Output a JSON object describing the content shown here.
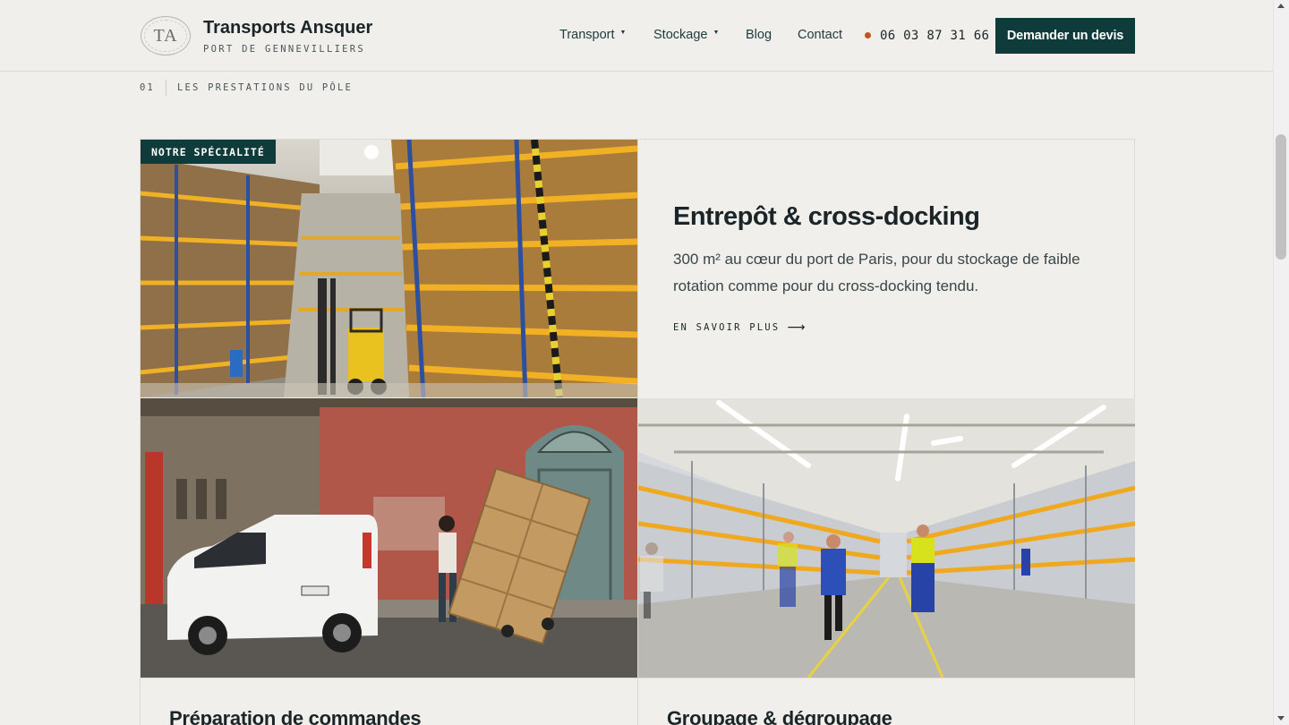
{
  "header": {
    "logo_text": "TA",
    "brand_title": "Transports Ansquer",
    "brand_subtitle": "PORT DE GENNEVILLIERS",
    "nav": [
      {
        "label": "Transport",
        "has_dropdown": true
      },
      {
        "label": "Stockage",
        "has_dropdown": true
      },
      {
        "label": "Blog",
        "has_dropdown": false
      },
      {
        "label": "Contact",
        "has_dropdown": false
      }
    ],
    "phone": "06 03 87 31 66",
    "cta_label": "Demander un devis"
  },
  "section": {
    "number": "01",
    "label": "LES PRESTATIONS DU PÔLE"
  },
  "featured": {
    "badge": "NOTRE SPÉCIALITÉ",
    "title": "Entrepôt & cross-docking",
    "description": "300 m² au cœur du port de Paris, pour du stockage de faible rotation comme pour du cross-docking tendu.",
    "link_label": "EN SAVOIR PLUS",
    "link_icon": "arrow-right-icon"
  },
  "cards": [
    {
      "title": "Préparation de commandes",
      "image": "delivery-van-boxes-photo"
    },
    {
      "title": "Groupage & dégroupage",
      "image": "warehouse-workers-photo"
    }
  ],
  "colors": {
    "background": "#f0efeb",
    "primary": "#0f3b3a",
    "accent_dot": "#c2531e",
    "text": "#1b2528"
  }
}
